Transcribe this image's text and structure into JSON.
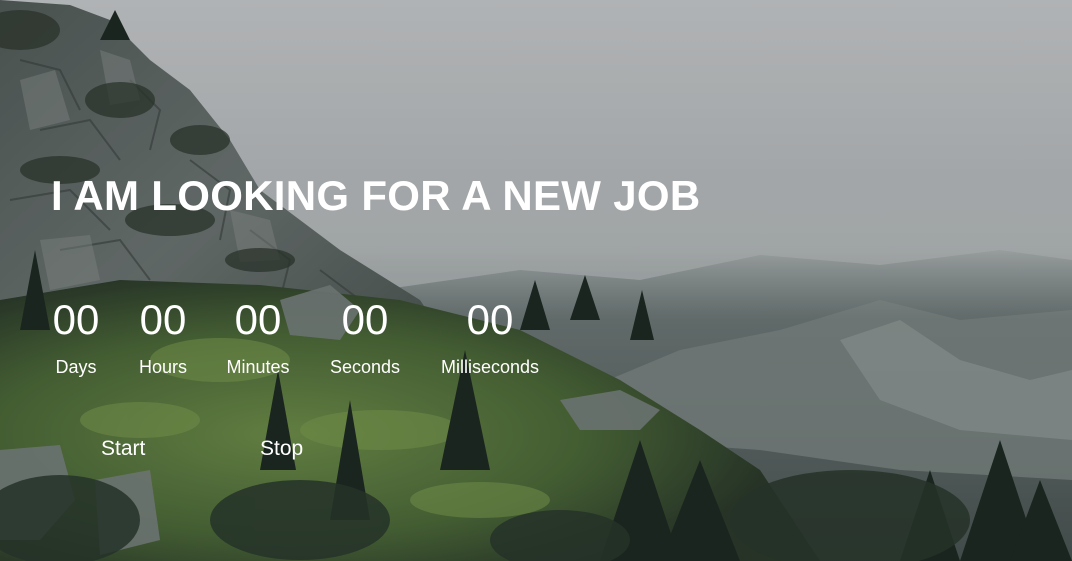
{
  "hero": {
    "headline": "I AM LOOKING FOR A NEW JOB"
  },
  "countdown": {
    "units": [
      {
        "value": "00",
        "label": "Days"
      },
      {
        "value": "00",
        "label": "Hours"
      },
      {
        "value": "00",
        "label": "Minutes"
      },
      {
        "value": "00",
        "label": "Seconds"
      },
      {
        "value": "00",
        "label": "Milliseconds"
      }
    ]
  },
  "controls": {
    "start_label": "Start",
    "stop_label": "Stop"
  }
}
